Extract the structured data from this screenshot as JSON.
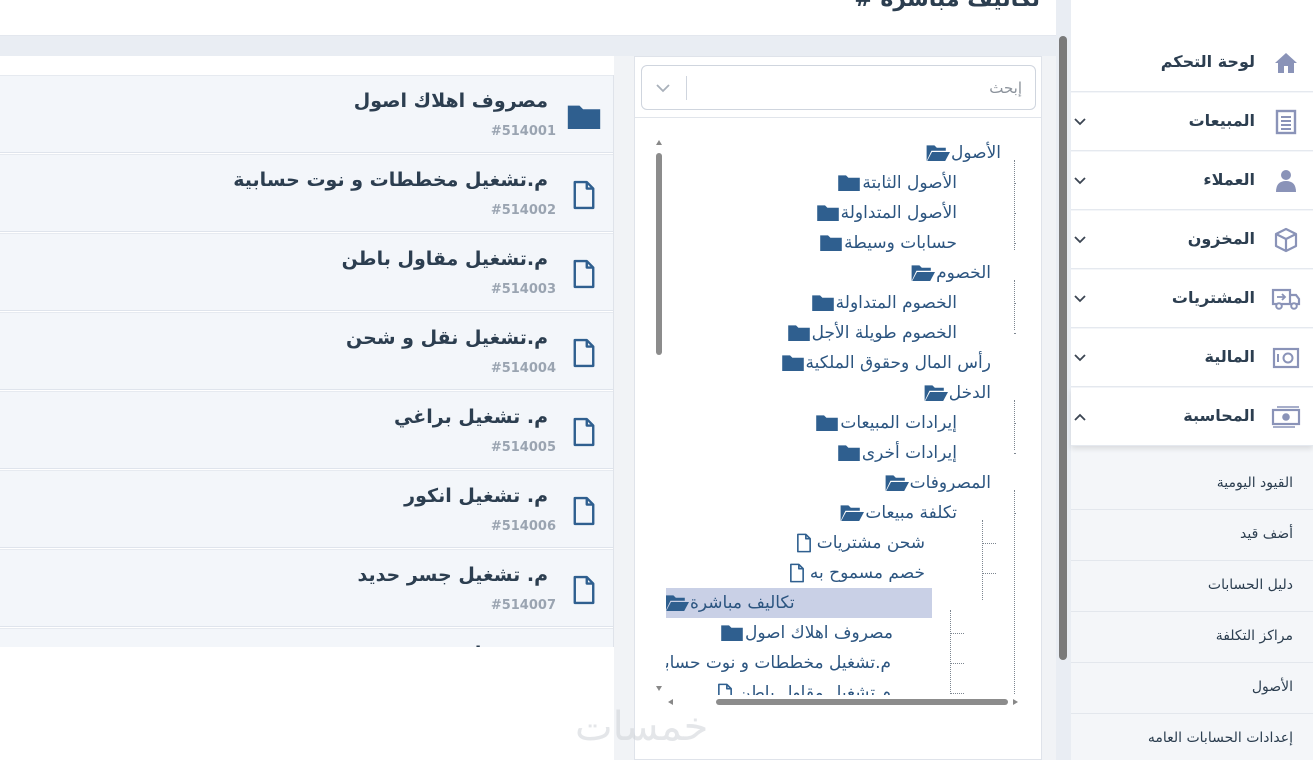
{
  "header": {
    "title": "تكاليف مباشرة #"
  },
  "accounts": [
    {
      "name": "مصروف اهلاك اصول",
      "code": "#514001",
      "icon": "folder-icon"
    },
    {
      "name": "م.تشغيل مخططات و نوت حسابية",
      "code": "#514002",
      "icon": "file-icon"
    },
    {
      "name": "م.تشغيل مقاول باطن",
      "code": "#514003",
      "icon": "file-icon"
    },
    {
      "name": "م.تشغيل نقل و شحن",
      "code": "#514004",
      "icon": "file-icon"
    },
    {
      "name": "م. تشغيل براغي",
      "code": "#514005",
      "icon": "file-icon"
    },
    {
      "name": "م. تشغيل انكور",
      "code": "#514006",
      "icon": "file-icon"
    },
    {
      "name": "م. تشغيل جسر حديد",
      "code": "#514007",
      "icon": "file-icon"
    },
    {
      "name": "م.تشغيل ...",
      "code": "",
      "icon": "file-icon"
    }
  ],
  "search": {
    "placeholder": "إبحث",
    "value": ""
  },
  "tree": [
    {
      "label": "الأصول",
      "icon": "folder-open-icon"
    },
    {
      "label": "الأصول الثابتة",
      "icon": "folder-icon"
    },
    {
      "label": "الأصول المتداولة",
      "icon": "folder-icon"
    },
    {
      "label": "حسابات وسيطة",
      "icon": "folder-icon"
    },
    {
      "label": "الخصوم",
      "icon": "folder-open-icon"
    },
    {
      "label": "الخصوم المتداولة",
      "icon": "folder-icon"
    },
    {
      "label": "الخصوم طويلة الأجل",
      "icon": "folder-icon"
    },
    {
      "label": "رأس المال وحقوق الملكية",
      "icon": "folder-icon"
    },
    {
      "label": "الدخل",
      "icon": "folder-open-icon"
    },
    {
      "label": "إيرادات المبيعات",
      "icon": "folder-icon"
    },
    {
      "label": "إيرادات أخرى",
      "icon": "folder-icon"
    },
    {
      "label": "المصروفات",
      "icon": "folder-open-icon"
    },
    {
      "label": "تكلفة مبيعات",
      "icon": "folder-open-icon"
    },
    {
      "label": "شحن مشتريات",
      "icon": "file-icon"
    },
    {
      "label": "خصم مسموح به",
      "icon": "file-icon"
    },
    {
      "label": "تكاليف مباشرة",
      "icon": "folder-open-icon",
      "selected": true
    },
    {
      "label": "مصروف اهلاك اصول",
      "icon": "folder-icon"
    },
    {
      "label": "م.تشغيل مخططات و نوت حسابية",
      "icon": "file-icon"
    },
    {
      "label": "م.تشغيل مقاول باطن",
      "icon": "file-icon"
    }
  ],
  "sidebar": {
    "items": [
      {
        "label": "لوحة التحكم",
        "icon": "home-icon",
        "expandable": false
      },
      {
        "label": "المبيعات",
        "icon": "receipt-icon",
        "expandable": true
      },
      {
        "label": "العملاء",
        "icon": "user-icon",
        "expandable": true
      },
      {
        "label": "المخزون",
        "icon": "box-icon",
        "expandable": true
      },
      {
        "label": "المشتريات",
        "icon": "truck-icon",
        "expandable": true
      },
      {
        "label": "المالية",
        "icon": "safe-icon",
        "expandable": true
      },
      {
        "label": "المحاسبة",
        "icon": "money-icon",
        "expandable": true,
        "open": true
      }
    ],
    "subitems": [
      {
        "label": "القيود اليومية"
      },
      {
        "label": "أضف قيد"
      },
      {
        "label": "دليل الحسابات"
      },
      {
        "label": "مراكز التكلفة"
      },
      {
        "label": "الأصول"
      },
      {
        "label": "إعدادات الحسابات العامه"
      }
    ]
  },
  "watermark": "خمسات",
  "colors": {
    "accent": "#2f5f8f",
    "text": "#2c3e50",
    "muted": "#9aa4b1",
    "selected": "#c9d0e6",
    "sidebar_icon": "#8a93b8"
  }
}
